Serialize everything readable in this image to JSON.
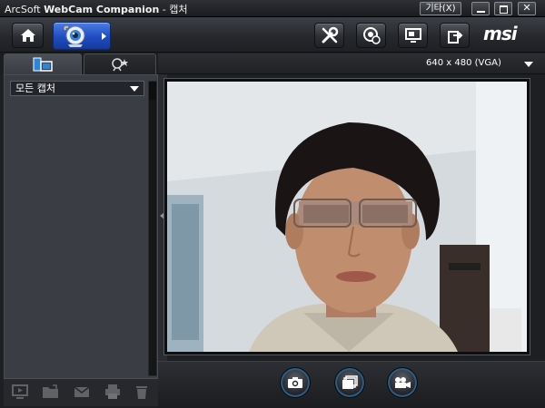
{
  "window": {
    "title_prefix": "ArcSoft ",
    "title_app": "WebCam Companion",
    "title_suffix": " - 캡처",
    "etc_button": "기타(X)"
  },
  "toolbar": {
    "home_icon": "home-icon",
    "capture_icon": "webcam-capture-icon",
    "tools_icon": "tools-icon",
    "webcam_icon": "webcam-settings-icon",
    "monitor_icon": "monitor-icon",
    "export_icon": "export-icon",
    "logo": "msi"
  },
  "left_panel": {
    "tabs": [
      {
        "name": "album",
        "icon": "photo-album-icon"
      },
      {
        "name": "effects",
        "icon": "magic-effects-icon"
      }
    ],
    "filter": "모든 캡처",
    "bottom_icons": [
      "slideshow-icon",
      "open-folder-icon",
      "email-icon",
      "print-icon",
      "trash-icon"
    ]
  },
  "preview": {
    "resolution": "640 x 480 (VGA)"
  },
  "capture_buttons": [
    {
      "name": "take-photo",
      "icon": "camera-icon"
    },
    {
      "name": "burst",
      "icon": "burst-frames-icon"
    },
    {
      "name": "record-video",
      "icon": "video-camera-icon"
    }
  ],
  "colors": {
    "accent": "#1f4cc0",
    "panel": "#3a3d43",
    "background": "#1d1f23"
  }
}
